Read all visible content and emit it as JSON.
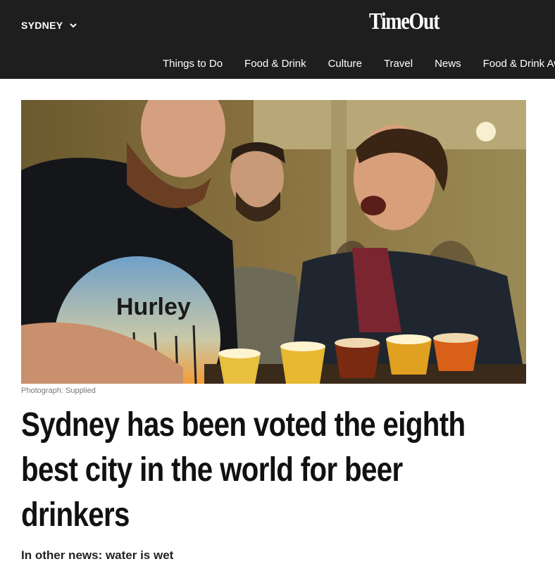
{
  "header": {
    "city_label": "SYDNEY",
    "logo_text": "TimeOut",
    "nav": [
      "Things to Do",
      "Food & Drink",
      "Culture",
      "Travel",
      "News",
      "Food & Drink Aw"
    ]
  },
  "hero": {
    "shirt_brand": "Hurley",
    "caption": "Photograph: Supplied"
  },
  "article": {
    "headline": "Sydney has been voted the eighth best city in the world for beer drinkers",
    "subhead": "In other news: water is wet"
  },
  "colors": {
    "header_bg": "#1e1e1e",
    "text": "#111111",
    "caption": "#777777"
  }
}
